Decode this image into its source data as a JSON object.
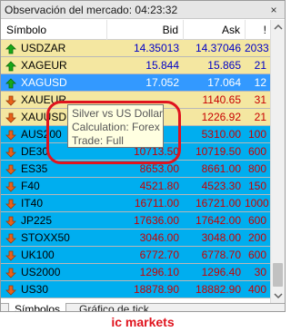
{
  "window": {
    "title": "Observación del mercado: 04:23:32",
    "close_glyph": "×"
  },
  "columns": {
    "symbol": "Símbolo",
    "bid": "Bid",
    "ask": "Ask",
    "extra": "!"
  },
  "rows": [
    {
      "symbol": "USDZAR",
      "bid": "14.35013",
      "ask": "14.37046",
      "extra": "2033",
      "direction": "up",
      "style": "yellow"
    },
    {
      "symbol": "XAGEUR",
      "bid": "15.844",
      "ask": "15.865",
      "extra": "21",
      "direction": "up",
      "style": "yellow"
    },
    {
      "symbol": "XAGUSD",
      "bid": "17.052",
      "ask": "17.064",
      "extra": "12",
      "direction": "up",
      "style": "selected"
    },
    {
      "symbol": "XAUEUR",
      "bid": "",
      "ask": "1140.65",
      "extra": "31",
      "direction": "down",
      "style": "yellow"
    },
    {
      "symbol": "XAUUSD",
      "bid": "",
      "ask": "1226.92",
      "extra": "21",
      "direction": "down",
      "style": "yellow"
    },
    {
      "symbol": "AUS200",
      "bid": "",
      "ask": "5310.00",
      "extra": "100",
      "direction": "down",
      "style": "blue"
    },
    {
      "symbol": "DE30",
      "bid": "10713.50",
      "ask": "10719.50",
      "extra": "600",
      "direction": "down",
      "style": "blue"
    },
    {
      "symbol": "ES35",
      "bid": "8653.00",
      "ask": "8661.00",
      "extra": "800",
      "direction": "down",
      "style": "blue"
    },
    {
      "symbol": "F40",
      "bid": "4521.80",
      "ask": "4523.30",
      "extra": "150",
      "direction": "down",
      "style": "blue"
    },
    {
      "symbol": "IT40",
      "bid": "16711.00",
      "ask": "16721.00",
      "extra": "1000",
      "direction": "down",
      "style": "blue"
    },
    {
      "symbol": "JP225",
      "bid": "17636.00",
      "ask": "17642.00",
      "extra": "600",
      "direction": "down",
      "style": "blue"
    },
    {
      "symbol": "STOXX50",
      "bid": "3046.00",
      "ask": "3048.00",
      "extra": "200",
      "direction": "down",
      "style": "blue"
    },
    {
      "symbol": "UK100",
      "bid": "6772.70",
      "ask": "6778.70",
      "extra": "600",
      "direction": "down",
      "style": "blue"
    },
    {
      "symbol": "US2000",
      "bid": "1296.10",
      "ask": "1296.40",
      "extra": "30",
      "direction": "down",
      "style": "blue"
    },
    {
      "symbol": "US30",
      "bid": "18878.90",
      "ask": "18882.90",
      "extra": "400",
      "direction": "down",
      "style": "blue"
    }
  ],
  "tooltip": {
    "line1": "Silver vs US Dollar",
    "line2": "Calculation: Forex",
    "line3": "Trade: Full"
  },
  "tabs": {
    "symbols": "Símbolos",
    "tick_chart": "Gráfico de tick"
  },
  "brand": "ic markets",
  "colors": {
    "row_yellow": "#f4e7a1",
    "row_blue": "#00aeef",
    "row_selected": "#3399ff",
    "up_arrow": "#18a818",
    "down_arrow": "#e8621a",
    "annotation": "#e0141e"
  }
}
